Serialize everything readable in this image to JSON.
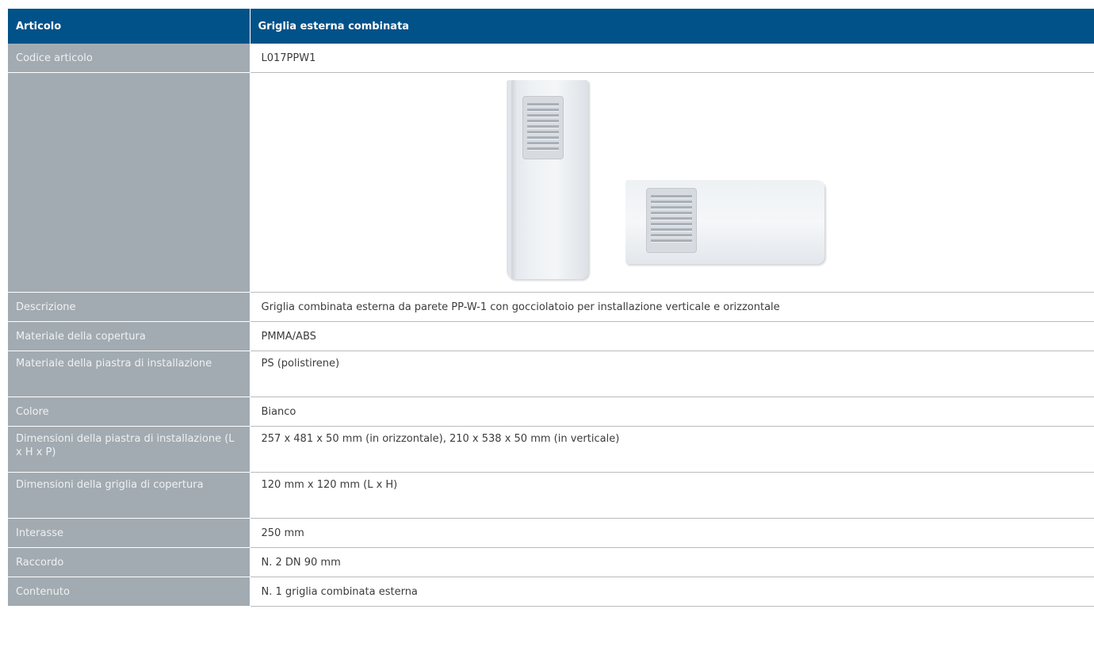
{
  "header": {
    "col1": "Articolo",
    "col2": "Griglia esterna combinata"
  },
  "rows": [
    {
      "label": "Codice articolo",
      "value": "L017PPW1"
    },
    {
      "label": "",
      "value": ""
    },
    {
      "label": "Descrizione",
      "value": "Griglia combinata esterna da parete PP-W-1 con gocciolatoio per installazione verticale e orizzontale"
    },
    {
      "label": "Materiale della copertura",
      "value": "PMMA/ABS"
    },
    {
      "label": "Materiale della piastra di installazione",
      "value": "PS (polistirene)"
    },
    {
      "label": "Colore",
      "value": "Bianco"
    },
    {
      "label": "Dimensioni della piastra di installazione (L x H x P)",
      "value": "257 x 481 x 50 mm (in orizzontale), 210 x 538 x 50 mm (in verticale)"
    },
    {
      "label": "Dimensioni della griglia di copertura",
      "value": "120 mm x 120 mm (L x H)"
    },
    {
      "label": "Interasse",
      "value": "250 mm"
    },
    {
      "label": "Raccordo",
      "value": "N. 2 DN 90 mm"
    },
    {
      "label": "Contenuto",
      "value": "N. 1 griglia combinata esterna"
    }
  ],
  "colors": {
    "header_bg": "#005289",
    "label_bg": "#a2abb1"
  }
}
